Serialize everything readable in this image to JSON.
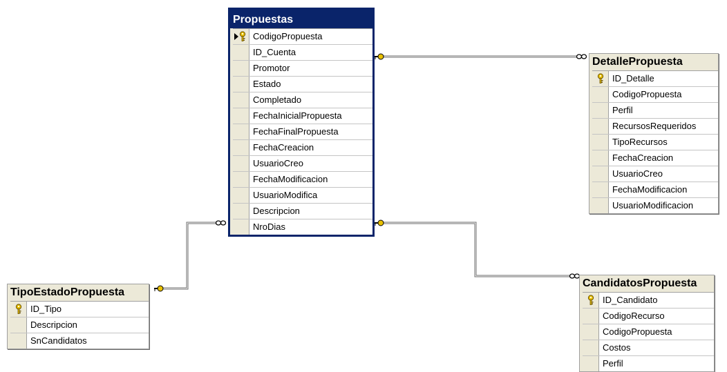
{
  "tables": {
    "propuestas": {
      "title": "Propuestas",
      "columns": [
        {
          "name": "CodigoPropuesta",
          "key": true
        },
        {
          "name": "ID_Cuenta",
          "key": false
        },
        {
          "name": "Promotor",
          "key": false
        },
        {
          "name": "Estado",
          "key": false
        },
        {
          "name": "Completado",
          "key": false
        },
        {
          "name": "FechaInicialPropuesta",
          "key": false
        },
        {
          "name": "FechaFinalPropuesta",
          "key": false
        },
        {
          "name": "FechaCreacion",
          "key": false
        },
        {
          "name": "UsuarioCreo",
          "key": false
        },
        {
          "name": "FechaModificacion",
          "key": false
        },
        {
          "name": "UsuarioModifica",
          "key": false
        },
        {
          "name": "Descripcion",
          "key": false
        },
        {
          "name": "NroDias",
          "key": false
        }
      ]
    },
    "detalle_propuesta": {
      "title": "DetallePropuesta",
      "columns": [
        {
          "name": "ID_Detalle",
          "key": true
        },
        {
          "name": "CodigoPropuesta",
          "key": false
        },
        {
          "name": "Perfil",
          "key": false
        },
        {
          "name": "RecursosRequeridos",
          "key": false
        },
        {
          "name": "TipoRecursos",
          "key": false
        },
        {
          "name": "FechaCreacion",
          "key": false
        },
        {
          "name": "UsuarioCreo",
          "key": false
        },
        {
          "name": "FechaModificacion",
          "key": false
        },
        {
          "name": "UsuarioModificacion",
          "key": false
        }
      ]
    },
    "tipo_estado_propuesta": {
      "title": "TipoEstadoPropuesta",
      "columns": [
        {
          "name": "ID_Tipo",
          "key": true
        },
        {
          "name": "Descripcion",
          "key": false
        },
        {
          "name": "SnCandidatos",
          "key": false
        }
      ]
    },
    "candidatos_propuesta": {
      "title": "CandidatosPropuesta",
      "columns": [
        {
          "name": "ID_Candidato",
          "key": true
        },
        {
          "name": "CodigoRecurso",
          "key": false
        },
        {
          "name": "CodigoPropuesta",
          "key": false
        },
        {
          "name": "Costos",
          "key": false
        },
        {
          "name": "Perfil",
          "key": false
        }
      ]
    }
  },
  "colors": {
    "title_selected_bg": "#0a246a",
    "header_bg": "#ece9d8",
    "key_icon": "#e8c000",
    "connector": "#6e6e6e"
  }
}
